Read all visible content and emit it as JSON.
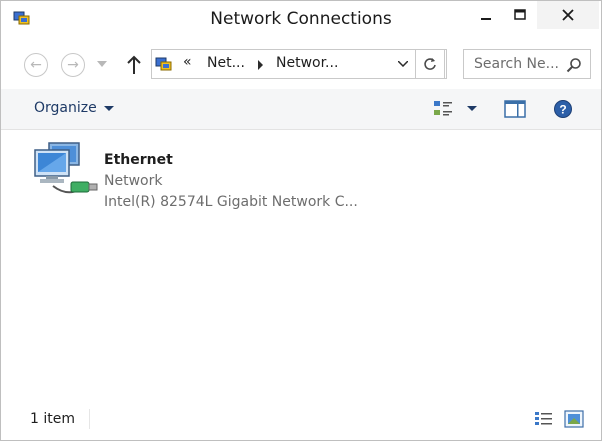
{
  "window": {
    "title": "Network Connections",
    "icon": "network-connections-icon"
  },
  "toolbar": {
    "address_crumbs": [
      "Net...",
      "Networ..."
    ],
    "address_overflow": "«",
    "search_placeholder": "Search Ne..."
  },
  "command_bar": {
    "organize_label": "Organize"
  },
  "items": [
    {
      "name": "Ethernet",
      "subtitle": "Network",
      "device": "Intel(R) 82574L Gigabit Network C..."
    }
  ],
  "status": {
    "count": "1 item"
  },
  "colors": {
    "accent": "#1e3a66",
    "muted_text": "#6d6d6d",
    "command_bar_bg": "#f5f6f7"
  }
}
